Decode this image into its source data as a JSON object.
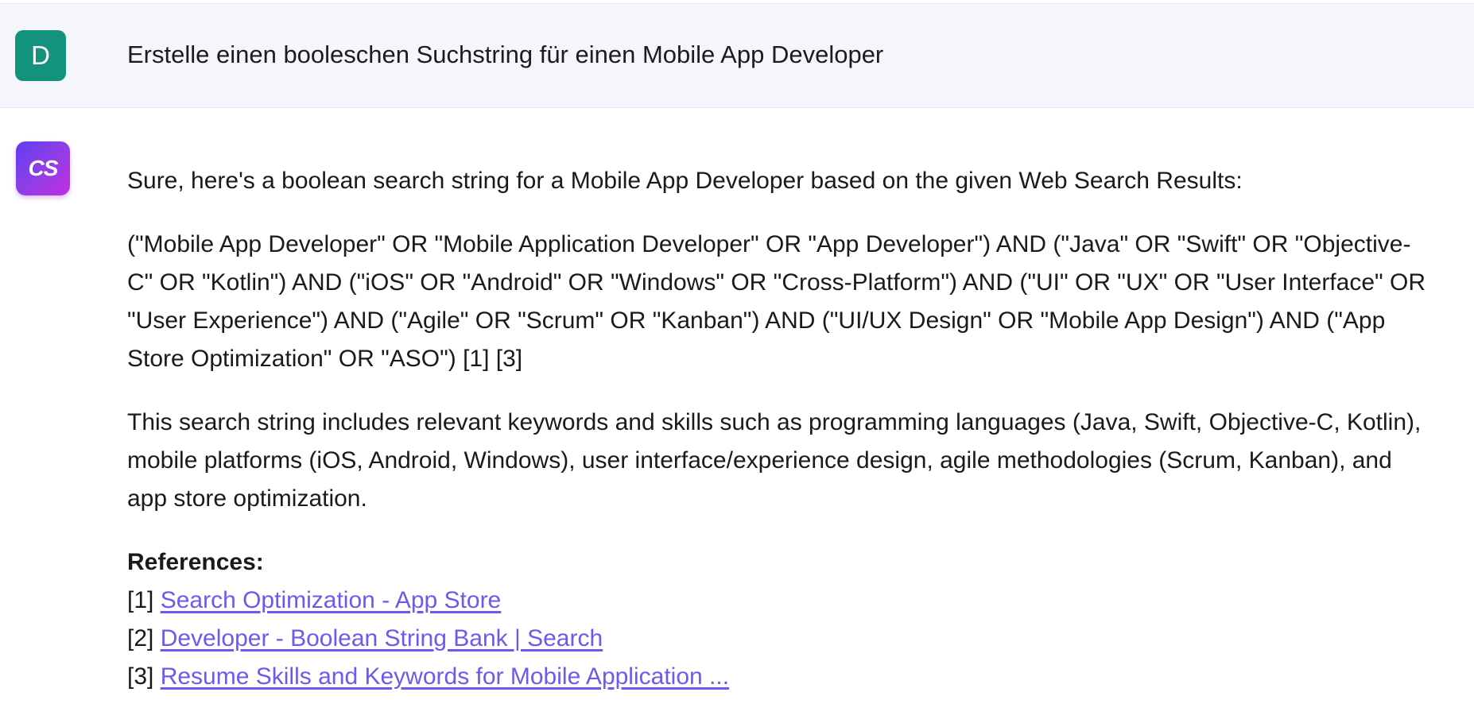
{
  "user_message": {
    "avatar_letter": "D",
    "text": "Erstelle einen booleschen Suchstring für einen Mobile App Developer"
  },
  "assistant_message": {
    "avatar_label": "CS",
    "intro": "Sure, here's a boolean search string for a Mobile App Developer based on the given Web Search Results:",
    "search_string": "(\"Mobile App Developer\" OR \"Mobile Application Developer\" OR \"App Developer\") AND (\"Java\" OR \"Swift\" OR \"Objective-C\" OR \"Kotlin\") AND (\"iOS\" OR \"Android\" OR \"Windows\" OR \"Cross-Platform\") AND (\"UI\" OR \"UX\" OR \"User Interface\" OR \"User Experience\") AND (\"Agile\" OR \"Scrum\" OR \"Kanban\") AND (\"UI/UX Design\" OR \"Mobile App Design\") AND (\"App Store Optimization\" OR \"ASO\") [1] [3]",
    "explanation": "This search string includes relevant keywords and skills such as programming languages (Java, Swift, Objective-C, Kotlin), mobile platforms (iOS, Android, Windows), user interface/experience design, agile methodologies (Scrum, Kanban), and app store optimization.",
    "references_title": "References:",
    "references": [
      {
        "index": "[1]",
        "label": "Search Optimization - App Store"
      },
      {
        "index": "[2]",
        "label": "Developer - Boolean String Bank | Search"
      },
      {
        "index": "[3]",
        "label": "Resume Skills and Keywords for Mobile Application ..."
      }
    ]
  },
  "colors": {
    "user_row_bg": "#f4f6fb",
    "user_avatar_bg": "#13937d",
    "link": "#6a5af0",
    "bot_avatar_gradient": [
      "#5f3df0",
      "#c12ee0"
    ]
  },
  "icons": {
    "user_avatar": "letter-avatar",
    "assistant_avatar": "cs-logo-icon"
  }
}
